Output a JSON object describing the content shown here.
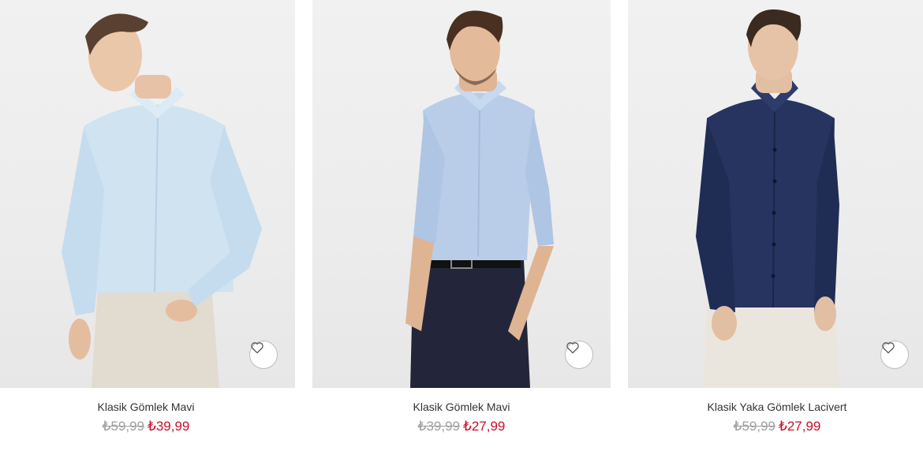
{
  "products": [
    {
      "title": "Klasik Gömlek Mavi",
      "old_price": "₺59,99",
      "new_price": "₺39,99",
      "image": "model-light-blue-shirt-beige-pants",
      "colors": {
        "shirt": "#cfe3f1",
        "pants": "#e2dbcf",
        "hair": "#5a4030"
      }
    },
    {
      "title": "Klasik Gömlek Mavi",
      "old_price": "₺39,99",
      "new_price": "₺27,99",
      "image": "model-light-blue-shirt-navy-trousers",
      "colors": {
        "shirt": "#b9cde9",
        "pants": "#23263a",
        "hair": "#4a3020"
      }
    },
    {
      "title": "Klasik Yaka Gömlek Lacivert",
      "old_price": "₺59,99",
      "new_price": "₺27,99",
      "image": "model-navy-shirt-white-pants",
      "colors": {
        "shirt": "#26345f",
        "pants": "#ebe6dd",
        "hair": "#3b2a1f"
      }
    }
  ],
  "favorite_icon": "heart-outline-icon",
  "price_colors": {
    "old": "#9e9e9e",
    "new": "#c8102e"
  }
}
